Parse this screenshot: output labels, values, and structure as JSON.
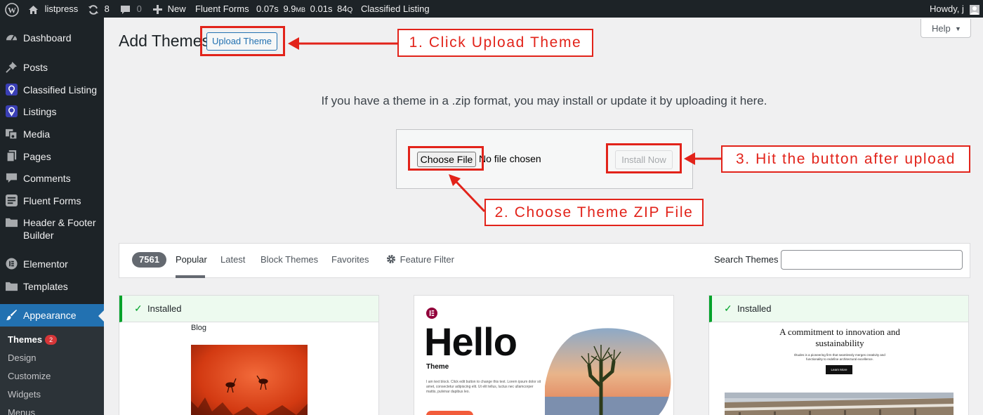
{
  "admin_bar": {
    "site_name": "listpress",
    "updates_count": "8",
    "comments_count": "0",
    "new_label": "New",
    "fluent_forms": "Fluent Forms",
    "perf": {
      "time1": "0.07s",
      "mem": "9.9",
      "mem_unit": "MB",
      "time2": "0.01s",
      "queries": "84",
      "queries_unit": "Q"
    },
    "classified_listing": "Classified Listing",
    "howdy": "Howdy, j"
  },
  "sidebar": {
    "items": [
      {
        "label": "Dashboard",
        "icon": "dashboard-icon"
      },
      {
        "label": "Posts",
        "icon": "pin-icon"
      },
      {
        "label": "Classified Listing",
        "icon": "listing-pin-icon"
      },
      {
        "label": "Listings",
        "icon": "listing-pin-icon"
      },
      {
        "label": "Media",
        "icon": "media-icon"
      },
      {
        "label": "Pages",
        "icon": "pages-icon"
      },
      {
        "label": "Comments",
        "icon": "comment-icon"
      },
      {
        "label": "Fluent Forms",
        "icon": "forms-icon"
      },
      {
        "label": "Header & Footer Builder",
        "icon": "folder-icon"
      },
      {
        "label": "Elementor",
        "icon": "elementor-icon"
      },
      {
        "label": "Templates",
        "icon": "folder-icon"
      },
      {
        "label": "Appearance",
        "icon": "brush-icon"
      }
    ],
    "submenu": [
      {
        "label": "Themes",
        "badge": "2"
      },
      {
        "label": "Design"
      },
      {
        "label": "Customize"
      },
      {
        "label": "Widgets"
      },
      {
        "label": "Menus"
      }
    ]
  },
  "page": {
    "title": "Add Themes",
    "upload_button": "Upload Theme",
    "help": "Help",
    "upload_description": "If you have a theme in a .zip format, you may install or update it by uploading it here.",
    "choose_file": "Choose File",
    "no_file": "No file chosen",
    "install_now": "Install Now"
  },
  "callouts": {
    "step1": "1. Click Upload Theme",
    "step2": "2. Choose Theme ZIP File",
    "step3": "3. Hit the button after upload"
  },
  "filter_bar": {
    "count": "7561",
    "tabs": [
      "Popular",
      "Latest",
      "Block Themes",
      "Favorites"
    ],
    "feature_filter": "Feature Filter",
    "search_label": "Search Themes"
  },
  "themes": [
    {
      "status": "Installed",
      "preview_text": "Blog"
    },
    {
      "status": "",
      "preview_title": "Hello",
      "preview_subtitle": "Theme",
      "preview_body": "I am text block. Click edit button to change this text. Lorem ipsum dolor sit amet, consectetur adipiscing elit. Ut elit tellus, luctus nec ullamcorper mattis, pulvinar dapibus leo."
    },
    {
      "status": "Installed",
      "preview_heading": "A commitment to innovation and sustainability",
      "preview_body": "Études is a pioneering firm that seamlessly merges creativity and functionality to redefine architectural excellence.",
      "preview_button": "Learn More"
    }
  ],
  "colors": {
    "admin_dark": "#1d2327",
    "accent_blue": "#2271b1",
    "annotation_red": "#e2231a",
    "installed_green": "#00a32a"
  }
}
